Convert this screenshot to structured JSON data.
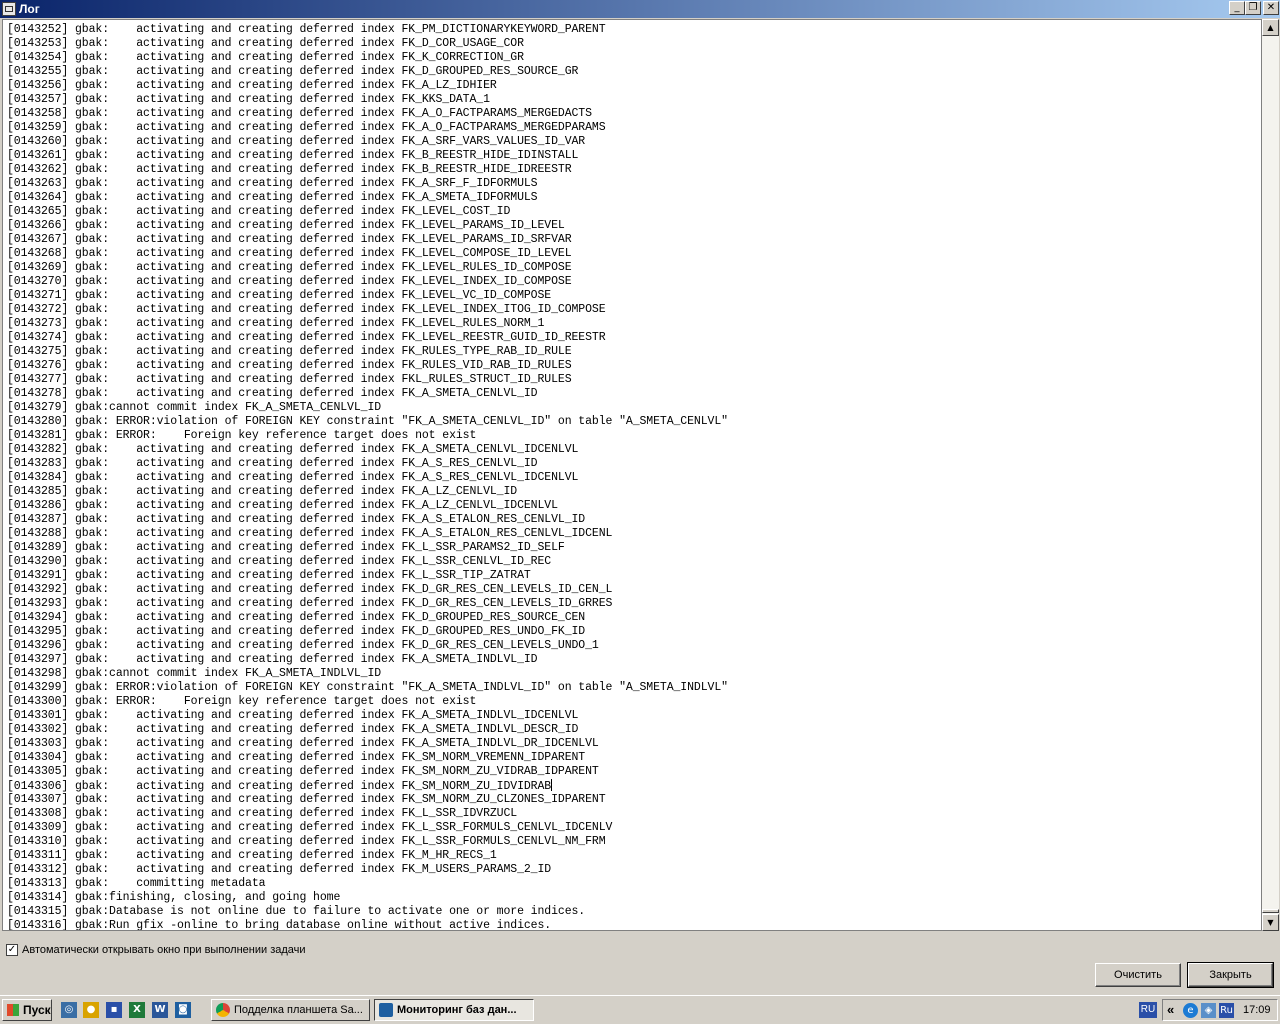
{
  "window": {
    "title": "Лог",
    "minimize_glyph": "_",
    "maximize_glyph": "❐",
    "close_glyph": "✕"
  },
  "log_lines": [
    "[0143252] gbak:    activating and creating deferred index FK_PM_DICTIONARYKEYWORD_PARENT",
    "[0143253] gbak:    activating and creating deferred index FK_D_COR_USAGE_COR",
    "[0143254] gbak:    activating and creating deferred index FK_K_CORRECTION_GR",
    "[0143255] gbak:    activating and creating deferred index FK_D_GROUPED_RES_SOURCE_GR",
    "[0143256] gbak:    activating and creating deferred index FK_A_LZ_IDHIER",
    "[0143257] gbak:    activating and creating deferred index FK_KKS_DATA_1",
    "[0143258] gbak:    activating and creating deferred index FK_A_O_FACTPARAMS_MERGEDACTS",
    "[0143259] gbak:    activating and creating deferred index FK_A_O_FACTPARAMS_MERGEDPARAMS",
    "[0143260] gbak:    activating and creating deferred index FK_A_SRF_VARS_VALUES_ID_VAR",
    "[0143261] gbak:    activating and creating deferred index FK_B_REESTR_HIDE_IDINSTALL",
    "[0143262] gbak:    activating and creating deferred index FK_B_REESTR_HIDE_IDREESTR",
    "[0143263] gbak:    activating and creating deferred index FK_A_SRF_F_IDFORMULS",
    "[0143264] gbak:    activating and creating deferred index FK_A_SMETA_IDFORMULS",
    "[0143265] gbak:    activating and creating deferred index FK_LEVEL_COST_ID",
    "[0143266] gbak:    activating and creating deferred index FK_LEVEL_PARAMS_ID_LEVEL",
    "[0143267] gbak:    activating and creating deferred index FK_LEVEL_PARAMS_ID_SRFVAR",
    "[0143268] gbak:    activating and creating deferred index FK_LEVEL_COMPOSE_ID_LEVEL",
    "[0143269] gbak:    activating and creating deferred index FK_LEVEL_RULES_ID_COMPOSE",
    "[0143270] gbak:    activating and creating deferred index FK_LEVEL_INDEX_ID_COMPOSE",
    "[0143271] gbak:    activating and creating deferred index FK_LEVEL_VC_ID_COMPOSE",
    "[0143272] gbak:    activating and creating deferred index FK_LEVEL_INDEX_ITOG_ID_COMPOSE",
    "[0143273] gbak:    activating and creating deferred index FK_LEVEL_RULES_NORM_1",
    "[0143274] gbak:    activating and creating deferred index FK_LEVEL_REESTR_GUID_ID_REESTR",
    "[0143275] gbak:    activating and creating deferred index FK_RULES_TYPE_RAB_ID_RULE",
    "[0143276] gbak:    activating and creating deferred index FK_RULES_VID_RAB_ID_RULES",
    "[0143277] gbak:    activating and creating deferred index FKL_RULES_STRUCT_ID_RULES",
    "[0143278] gbak:    activating and creating deferred index FK_A_SMETA_CENLVL_ID",
    "[0143279] gbak:cannot commit index FK_A_SMETA_CENLVL_ID",
    "[0143280] gbak: ERROR:violation of FOREIGN KEY constraint \"FK_A_SMETA_CENLVL_ID\" on table \"A_SMETA_CENLVL\"",
    "[0143281] gbak: ERROR:    Foreign key reference target does not exist",
    "[0143282] gbak:    activating and creating deferred index FK_A_SMETA_CENLVL_IDCENLVL",
    "[0143283] gbak:    activating and creating deferred index FK_A_S_RES_CENLVL_ID",
    "[0143284] gbak:    activating and creating deferred index FK_A_S_RES_CENLVL_IDCENLVL",
    "[0143285] gbak:    activating and creating deferred index FK_A_LZ_CENLVL_ID",
    "[0143286] gbak:    activating and creating deferred index FK_A_LZ_CENLVL_IDCENLVL",
    "[0143287] gbak:    activating and creating deferred index FK_A_S_ETALON_RES_CENLVL_ID",
    "[0143288] gbak:    activating and creating deferred index FK_A_S_ETALON_RES_CENLVL_IDCENL",
    "[0143289] gbak:    activating and creating deferred index FK_L_SSR_PARAMS2_ID_SELF",
    "[0143290] gbak:    activating and creating deferred index FK_L_SSR_CENLVL_ID_REC",
    "[0143291] gbak:    activating and creating deferred index FK_L_SSR_TIP_ZATRAT",
    "[0143292] gbak:    activating and creating deferred index FK_D_GR_RES_CEN_LEVELS_ID_CEN_L",
    "[0143293] gbak:    activating and creating deferred index FK_D_GR_RES_CEN_LEVELS_ID_GRRES",
    "[0143294] gbak:    activating and creating deferred index FK_D_GROUPED_RES_SOURCE_CEN",
    "[0143295] gbak:    activating and creating deferred index FK_D_GROUPED_RES_UNDO_FK_ID",
    "[0143296] gbak:    activating and creating deferred index FK_D_GR_RES_CEN_LEVELS_UNDO_1",
    "[0143297] gbak:    activating and creating deferred index FK_A_SMETA_INDLVL_ID",
    "[0143298] gbak:cannot commit index FK_A_SMETA_INDLVL_ID",
    "[0143299] gbak: ERROR:violation of FOREIGN KEY constraint \"FK_A_SMETA_INDLVL_ID\" on table \"A_SMETA_INDLVL\"",
    "[0143300] gbak: ERROR:    Foreign key reference target does not exist",
    "[0143301] gbak:    activating and creating deferred index FK_A_SMETA_INDLVL_IDCENLVL",
    "[0143302] gbak:    activating and creating deferred index FK_A_SMETA_INDLVL_DESCR_ID",
    "[0143303] gbak:    activating and creating deferred index FK_A_SMETA_INDLVL_DR_IDCENLVL",
    "[0143304] gbak:    activating and creating deferred index FK_SM_NORM_VREMENN_IDPARENT",
    "[0143305] gbak:    activating and creating deferred index FK_SM_NORM_ZU_VIDRAB_IDPARENT",
    "[0143306] gbak:    activating and creating deferred index FK_SM_NORM_ZU_IDVIDRAB",
    "[0143307] gbak:    activating and creating deferred index FK_SM_NORM_ZU_CLZONES_IDPARENT",
    "[0143308] gbak:    activating and creating deferred index FK_L_SSR_IDVRZUCL",
    "[0143309] gbak:    activating and creating deferred index FK_L_SSR_FORMULS_CENLVL_IDCENLV",
    "[0143310] gbak:    activating and creating deferred index FK_L_SSR_FORMULS_CENLVL_NM_FRM",
    "[0143311] gbak:    activating and creating deferred index FK_M_HR_RECS_1",
    "[0143312] gbak:    activating and creating deferred index FK_M_USERS_PARAMS_2_ID",
    "[0143313] gbak:    committing metadata",
    "[0143314] gbak:finishing, closing, and going home",
    "[0143315] gbak:Database is not online due to failure to activate one or more indices.",
    "[0143316] gbak:Run gfix -online to bring database online without active indices."
  ],
  "caret_line_index": 54,
  "scrollbar": {
    "up_glyph": "▲",
    "down_glyph": "▼"
  },
  "auto_open": {
    "label": "Автоматически открывать окно при  выполнении задачи",
    "checked": true,
    "check_glyph": "✓"
  },
  "buttons": {
    "clear": "Очистить",
    "close": "Закрыть"
  },
  "taskbar": {
    "start_label": "Пуск",
    "quicklaunch": [
      {
        "name": "globe-icon",
        "glyph": "◎",
        "color": "#3a6ea5"
      },
      {
        "name": "chrome-icon",
        "glyph": "●",
        "color": "#d9a300"
      },
      {
        "name": "save-icon",
        "glyph": "▪",
        "color": "#2a4fa8"
      },
      {
        "name": "excel-icon",
        "glyph": "X",
        "color": "#1f7a3a"
      },
      {
        "name": "word-icon",
        "glyph": "W",
        "color": "#2b579a"
      },
      {
        "name": "app-icon",
        "glyph": "◙",
        "color": "#1e5fa0"
      }
    ],
    "tasks": [
      {
        "label": "Подделка планшета Sa...",
        "active": false
      },
      {
        "label": "Мониторинг баз дан...",
        "active": true
      }
    ],
    "lang": "RU",
    "tray": {
      "chevron": "«",
      "ie_glyph": "e",
      "net_glyph": "◈",
      "lang": "Ru",
      "clock": "17:09"
    }
  }
}
